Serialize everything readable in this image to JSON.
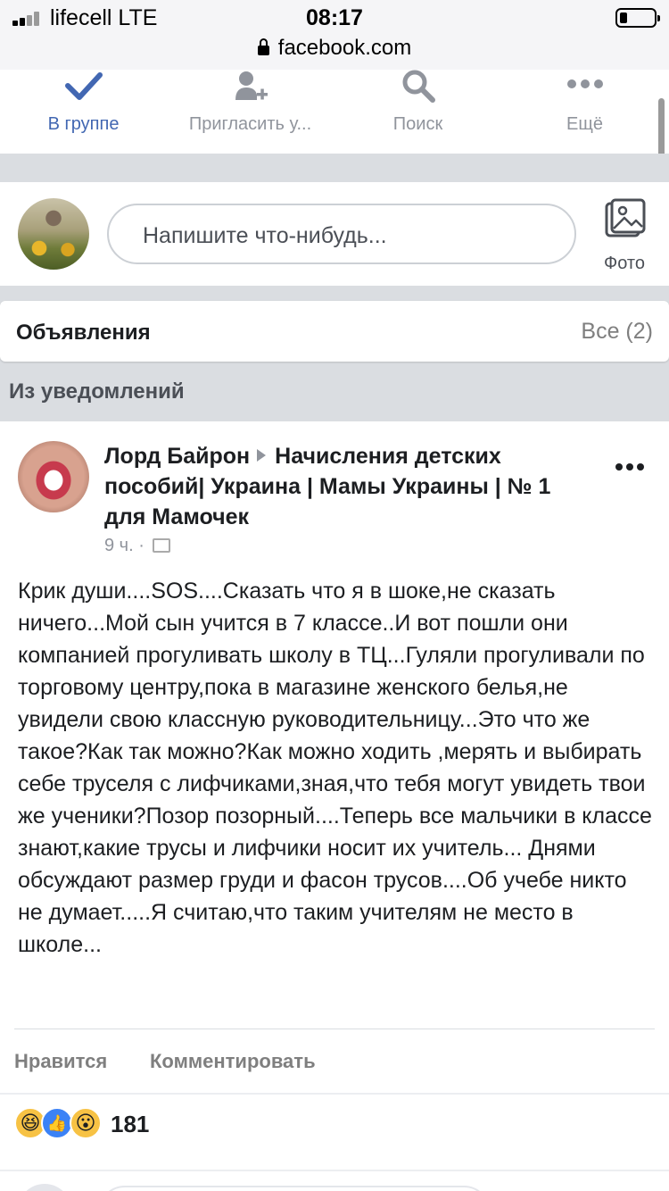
{
  "status_bar": {
    "carrier": "lifecell  LTE",
    "time": "08:17",
    "url": "facebook.com"
  },
  "actions": [
    {
      "label": "В группе",
      "icon": "check-icon",
      "active": true
    },
    {
      "label": "Пригласить у...",
      "icon": "add-person-icon",
      "active": false
    },
    {
      "label": "Поиск",
      "icon": "search-icon",
      "active": false
    },
    {
      "label": "Ещё",
      "icon": "more-dots-icon",
      "active": false
    }
  ],
  "composer": {
    "placeholder": "Напишите что-нибудь...",
    "photo_label": "Фото"
  },
  "announcements": {
    "title": "Объявления",
    "all": "Все (2)"
  },
  "section_title": "Из уведомлений",
  "post": {
    "author": "Лорд Байрон",
    "group": "Начисления детских пособий| Украина | Мамы Украины | № 1 для Мамочек",
    "time": "9 ч. ·",
    "text": "Крик души....SOS....Сказать что я в шоке,не сказать ничего...Мой сын учится в 7 классе..И вот пошли они компанией прогуливать школу в ТЦ...Гуляли прогуливали по торговому центру,пока в магазине женского белья,не увидели свою классную руководительницу...Это что же такое?Как так можно?Как можно ходить ,мерять и выбирать себе труселя с лифчиками,зная,что тебя могут увидеть твои же ученики?Позор позорный....Теперь все мальчики в классе знают,какие трусы и лифчики носит их учитель... Днями обсуждают размер груди и фасон трусов....Об учебе никто не думает.....Я считаю,что таким учителям не место в школе...",
    "like_label": "Нравится",
    "comment_label": "Комментировать",
    "reactions": [
      "haha",
      "like",
      "wow"
    ],
    "reaction_count": "181"
  },
  "colors": {
    "accent": "#4267b2",
    "divider": "#dadde1",
    "muted": "#90949c"
  }
}
